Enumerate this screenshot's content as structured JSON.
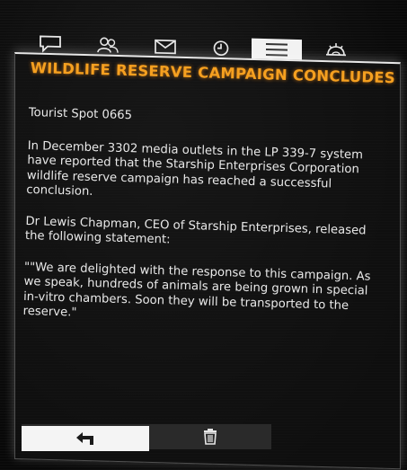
{
  "tabs": [
    {
      "name": "comms",
      "icon": "chat-bubble-icon",
      "active": false
    },
    {
      "name": "contacts",
      "icon": "people-icon",
      "active": false
    },
    {
      "name": "inbox",
      "icon": "envelope-icon",
      "active": false
    },
    {
      "name": "history",
      "icon": "clock-icon",
      "active": false
    },
    {
      "name": "galnet",
      "icon": "menu-lines-icon",
      "active": true
    },
    {
      "name": "settings",
      "icon": "gear-handshake-icon",
      "active": false
    }
  ],
  "article": {
    "title": "WILDLIFE RESERVE CAMPAIGN CONCLUDES",
    "paragraphs": [
      "Tourist Spot 0665",
      "In December 3302 media outlets in the LP 339-7 system have reported that the Starship Enterprises Corporation wildlife reserve campaign has reached a successful conclusion.",
      "Dr Lewis Chapman, CEO of Starship Enterprises, released the following statement:",
      "\"\"We are delighted with the response to this campaign. As we speak, hundreds of animals are being grown in special in-vitro chambers. Soon they will be transported to the reserve.\""
    ]
  },
  "actions": {
    "back_icon": "back-arrow-icon",
    "delete_icon": "trash-icon"
  },
  "colors": {
    "title": "#f5a020",
    "text": "#e9e9e9",
    "active_tab": "#f2f2f2"
  }
}
